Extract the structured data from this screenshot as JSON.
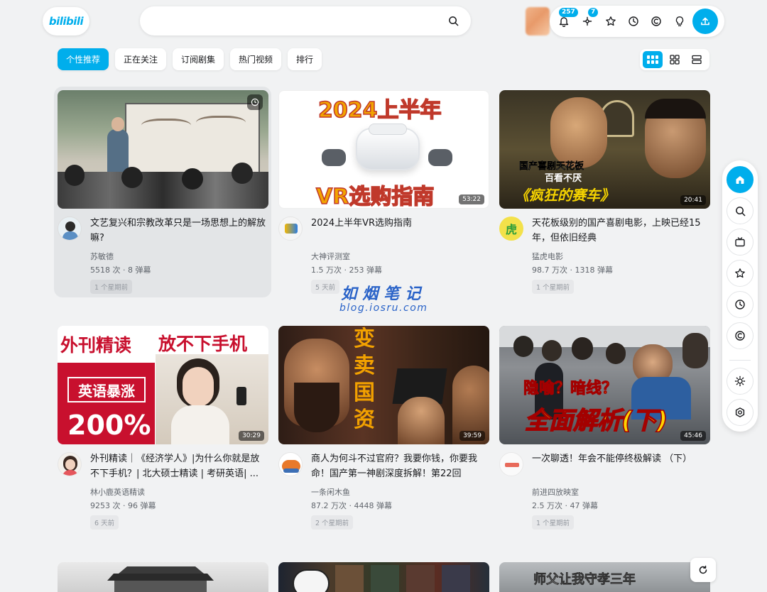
{
  "header": {
    "logo": "bilibili",
    "search_value": "",
    "notif_badge": "257",
    "dynamic_badge": "7"
  },
  "tabs": [
    "个性推荐",
    "正在关注",
    "订阅剧集",
    "热门视频",
    "排行"
  ],
  "cards": [
    {
      "title": "文艺复兴和宗教改革只是一场思想上的解放嘛?",
      "author": "苏敏德",
      "stats": "5518 次 · 8 弹幕",
      "when": "1 个星期前",
      "duration": ""
    },
    {
      "title": "2024上半年VR选购指南",
      "author": "大神评测室",
      "stats": "1.5 万次 · 253 弹幕",
      "when": "5 天前",
      "duration": "53:22",
      "thumb_top": "2024上半年",
      "thumb_bottom": "VR选购指南"
    },
    {
      "title": "天花板级别的国产喜剧电影，上映已经15年，但依旧经典",
      "author": "猛虎电影",
      "stats": "98.7 万次 · 1318 弹幕",
      "when": "1 个星期前",
      "duration": "20:41",
      "thumb_l1": "国产喜剧天花板",
      "thumb_l2": "百看不厌",
      "thumb_l3": "《疯狂的赛车》",
      "avatar_text": "虎"
    },
    {
      "title": "外刊精读｜《经济学人》|为什么你就是放不下手机？| 北大硕士精读 | 考研英语| ...",
      "author": "林小鹿英语精读",
      "stats": "9253 次 · 96 弹幕",
      "when": "6 天前",
      "duration": "30:29",
      "thumb_l1": "外刊精读",
      "thumb_l2": "放不下手机",
      "thumb_l3": "英语暴涨",
      "thumb_l4": "200%"
    },
    {
      "title": "商人为何斗不过官府？我要你钱，你要我命！国产第一神剧深度拆解！第22回",
      "author": "一条闲木鱼",
      "stats": "87.2 万次 · 4448 弹幕",
      "when": "2 个星期前",
      "duration": "39:59",
      "thumb_l1": "变卖国资"
    },
    {
      "title": "一次聊透！年会不能停终极解读 （下）",
      "author": "前进四放映室",
      "stats": "2.5 万次 · 47 弹幕",
      "when": "1 个星期前",
      "duration": "45:46",
      "thumb_l1": "隐喻？暗线？",
      "thumb_l2": "全面解析(下)"
    }
  ],
  "row3_thumb_text": "师父让我守孝三年",
  "watermark": {
    "line1": "如烟笔记",
    "line2": "blog.iosru.com"
  }
}
